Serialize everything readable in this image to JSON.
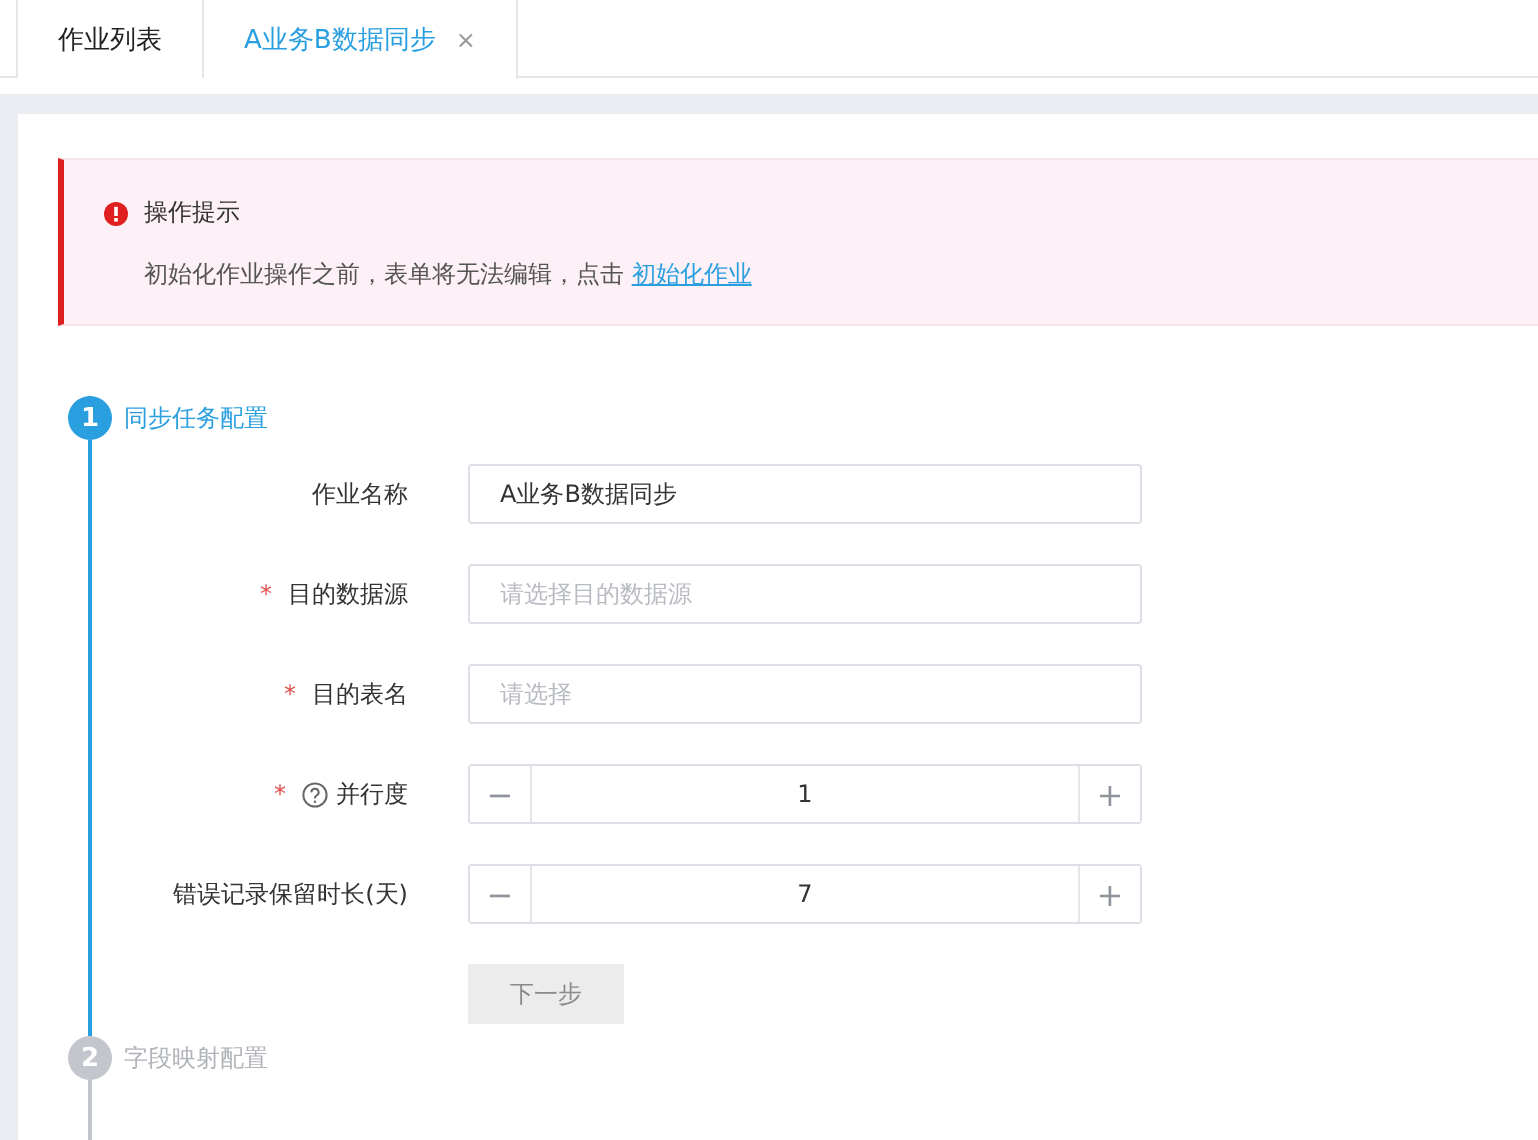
{
  "tabs": [
    {
      "label": "作业列表",
      "selected": false
    },
    {
      "label": "A业务B数据同步",
      "selected": true,
      "close": "×"
    }
  ],
  "alert": {
    "title": "操作提示",
    "message": "初始化作业操作之前，表单将无法编辑，点击",
    "link": "初始化作业"
  },
  "steps": [
    {
      "number": "1",
      "title": "同步任务配置",
      "selected": true,
      "fields": [
        {
          "kind": "text",
          "label": "作业名称",
          "help": false,
          "value": "A业务B数据同步"
        },
        {
          "kind": "select",
          "label": "目的数据源",
          "required_mark": "*",
          "help": false,
          "placeholder": "请选择目的数据源"
        },
        {
          "kind": "select",
          "label": "目的表名",
          "required_mark": "*",
          "help": false,
          "placeholder": "请选择"
        },
        {
          "kind": "number",
          "label": "并行度",
          "required_mark": "*",
          "help": true,
          "value": "1",
          "minus": "−",
          "plus": "+"
        },
        {
          "kind": "number",
          "label": "错误记录保留时长(天)",
          "help": false,
          "value": "7",
          "minus": "−",
          "plus": "+"
        }
      ],
      "button": {
        "label": "下一步",
        "disabled": true
      }
    },
    {
      "number": "2",
      "title": "字段映射配置",
      "selected": false
    }
  ]
}
